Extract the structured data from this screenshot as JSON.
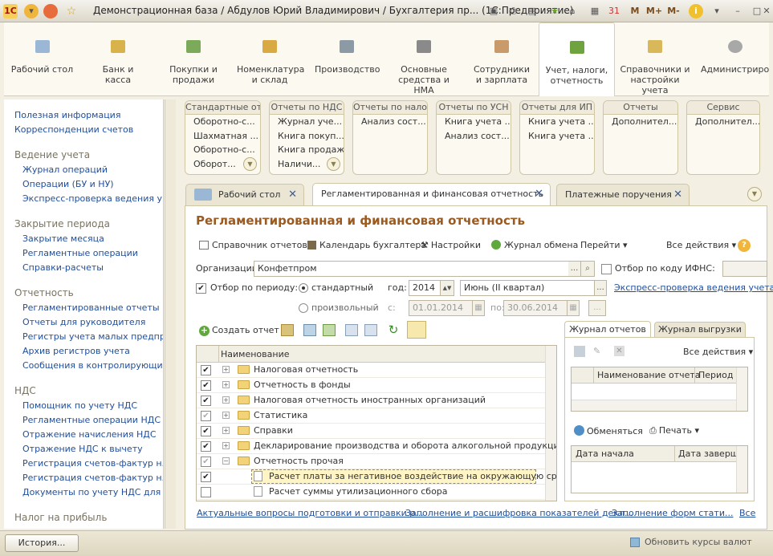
{
  "window": {
    "title": "Демонстрационная база / Абдулов Юрий Владимирович / Бухгалтерия пр...   (1С:Предприятие)",
    "memory_buttons": [
      "M",
      "M+",
      "M-"
    ]
  },
  "sections": [
    {
      "label": "Рабочий стол",
      "icon": "desktop-icon"
    },
    {
      "label": "Банк и касса",
      "icon": "bank-icon"
    },
    {
      "label": "Покупки и продажи",
      "icon": "cart-icon"
    },
    {
      "label": "Номенклатура и склад",
      "icon": "warehouse-icon"
    },
    {
      "label": "Производство",
      "icon": "production-icon"
    },
    {
      "label": "Основные средства и НМА",
      "icon": "truck-icon"
    },
    {
      "label": "Сотрудники и зарплата",
      "icon": "people-icon"
    },
    {
      "label": "Учет, налоги, отчетность",
      "icon": "book-icon"
    },
    {
      "label": "Справочники и настройки учета",
      "icon": "reference-icon"
    },
    {
      "label": "Администриро",
      "icon": "gear-icon"
    }
  ],
  "left_panel": {
    "top_links": [
      "Полезная информация",
      "Корреспонденции счетов"
    ],
    "groups": [
      {
        "title": "Ведение учета",
        "items": [
          "Журнал операций",
          "Операции (БУ и НУ)",
          "Экспресс-проверка ведения у..."
        ]
      },
      {
        "title": "Закрытие периода",
        "items": [
          "Закрытие месяца",
          "Регламентные операции",
          "Справки-расчеты"
        ]
      },
      {
        "title": "Отчетность",
        "items": [
          "Регламентированные отчеты",
          "Отчеты для руководителя",
          "Регистры учета малых предпр...",
          "Архив регистров учета",
          "Сообщения в контролирующи..."
        ]
      },
      {
        "title": "НДС",
        "items": [
          "Помощник по учету НДС",
          "Регламентные операции НДС",
          "Отражение начисления НДС",
          "Отражение НДС к вычету",
          "Регистрация счетов-фактур н...",
          "Регистрация счетов-фактур н...",
          "Документы по учету НДС для ..."
        ]
      },
      {
        "title": "Налог на прибыль",
        "items": []
      }
    ]
  },
  "report_groups": [
    {
      "title": "Стандартные от...",
      "items": [
        "Оборотно-с...",
        "Шахматная ...",
        "Оборотно-с...",
        "Оборот..."
      ]
    },
    {
      "title": "Отчеты по НДС",
      "items": [
        "Журнал уче...",
        "Книга покуп...",
        "Книга продаж",
        "Наличи..."
      ]
    },
    {
      "title": "Отчеты по нало...",
      "items": [
        "Анализ сост..."
      ]
    },
    {
      "title": "Отчеты по УСН",
      "items": [
        "Книга учета ...",
        "Анализ сост..."
      ]
    },
    {
      "title": "Отчеты для ИП",
      "items": [
        "Книга учета ...",
        "Книга учета ..."
      ]
    },
    {
      "title": "Отчеты",
      "items": [
        "Дополнител..."
      ]
    },
    {
      "title": "Сервис",
      "items": [
        "Дополнител..."
      ]
    }
  ],
  "tabs": [
    "Рабочий стол",
    "Регламентированная и финансовая отчетность",
    "Платежные поручения"
  ],
  "form": {
    "title": "Регламентированная и финансовая отчетность",
    "toolbar": {
      "reports_dir": "Справочник отчетов",
      "calendar": "Календарь бухгалтера",
      "settings": "Настройки",
      "exchange": "Журнал обмена",
      "goto": "Перейти",
      "all_actions": "Все действия"
    },
    "org_label": "Организации:",
    "org_value": "Конфетпром",
    "ifns_label": "Отбор по коду ИФНС:",
    "period_label": "Отбор по периоду:",
    "standard": "стандартный",
    "year_label": "год:",
    "year": "2014",
    "quarter": "Июнь (II квартал)",
    "express_link": "Экспресс-проверка ведения учета",
    "arbitrary": "произвольный",
    "from_label": "с:",
    "from": "01.01.2014",
    "to_label": "по:",
    "to": "30.06.2014",
    "dots": "...",
    "create_report": "Создать отчет",
    "tree_header": "Наименование",
    "tree_rows": [
      {
        "name": "Налоговая отчетность",
        "checked": "✔",
        "type": "folder",
        "expander": "+"
      },
      {
        "name": "Отчетность в фонды",
        "checked": "✔",
        "type": "folder",
        "expander": "+"
      },
      {
        "name": "Налоговая отчетность иностранных организаций",
        "checked": "✔",
        "type": "folder",
        "expander": "+"
      },
      {
        "name": "Статистика",
        "checked": "✔",
        "type": "folder",
        "expander": "+"
      },
      {
        "name": "Справки",
        "checked": "✔",
        "type": "folder",
        "expander": "+"
      },
      {
        "name": "Декларирование производства и оборота алкогольной продукции",
        "checked": "✔",
        "type": "folder",
        "expander": "+"
      },
      {
        "name": "Отчетность прочая",
        "checked": "✔",
        "type": "folder",
        "expander": "−"
      },
      {
        "name": "Расчет платы за негативное воздействие на окружающую среду",
        "checked": "✔",
        "type": "doc",
        "expander": ""
      },
      {
        "name": "Расчет суммы утилизационного сбора",
        "checked": "",
        "type": "doc",
        "expander": ""
      }
    ],
    "right_tabs": [
      "Журнал отчетов",
      "Журнал выгрузки"
    ],
    "right_all_actions": "Все действия",
    "journal_cols": [
      "Наименование отчета",
      "Период"
    ],
    "exchange_btn": "Обменяться",
    "print_btn": "Печать",
    "dates_cols": [
      "Дата начала",
      "Дата заверше"
    ],
    "bottom_links": [
      "Актуальные вопросы подготовки и отправки р...",
      "Заполнение и расшифровка показателей декл...",
      "Заполнение форм стати...",
      "Все"
    ]
  },
  "footer": {
    "history": "История...",
    "update_rates": "Обновить курсы валют"
  }
}
